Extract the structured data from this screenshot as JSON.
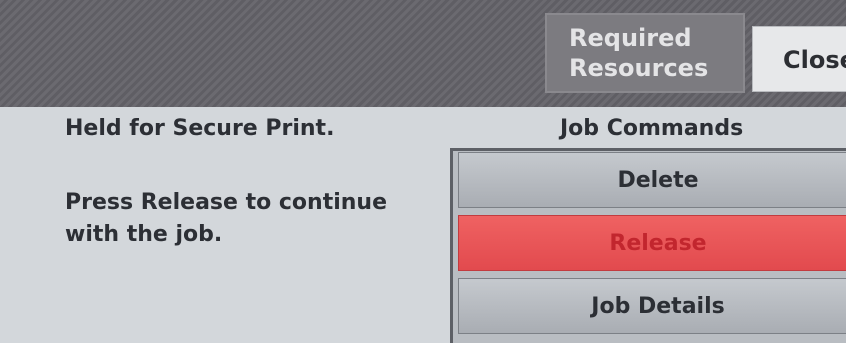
{
  "header": {
    "required_resources_label_line1": "Required",
    "required_resources_label_line2": "Resources",
    "close_label": "Close"
  },
  "status": {
    "title": "Held for Secure Print.",
    "message": "Press Release to continue with the job."
  },
  "job_commands": {
    "heading": "Job Commands",
    "buttons": [
      {
        "label": "Delete"
      },
      {
        "label": "Release",
        "color": "#e24a4e"
      },
      {
        "label": "Job Details"
      }
    ]
  }
}
